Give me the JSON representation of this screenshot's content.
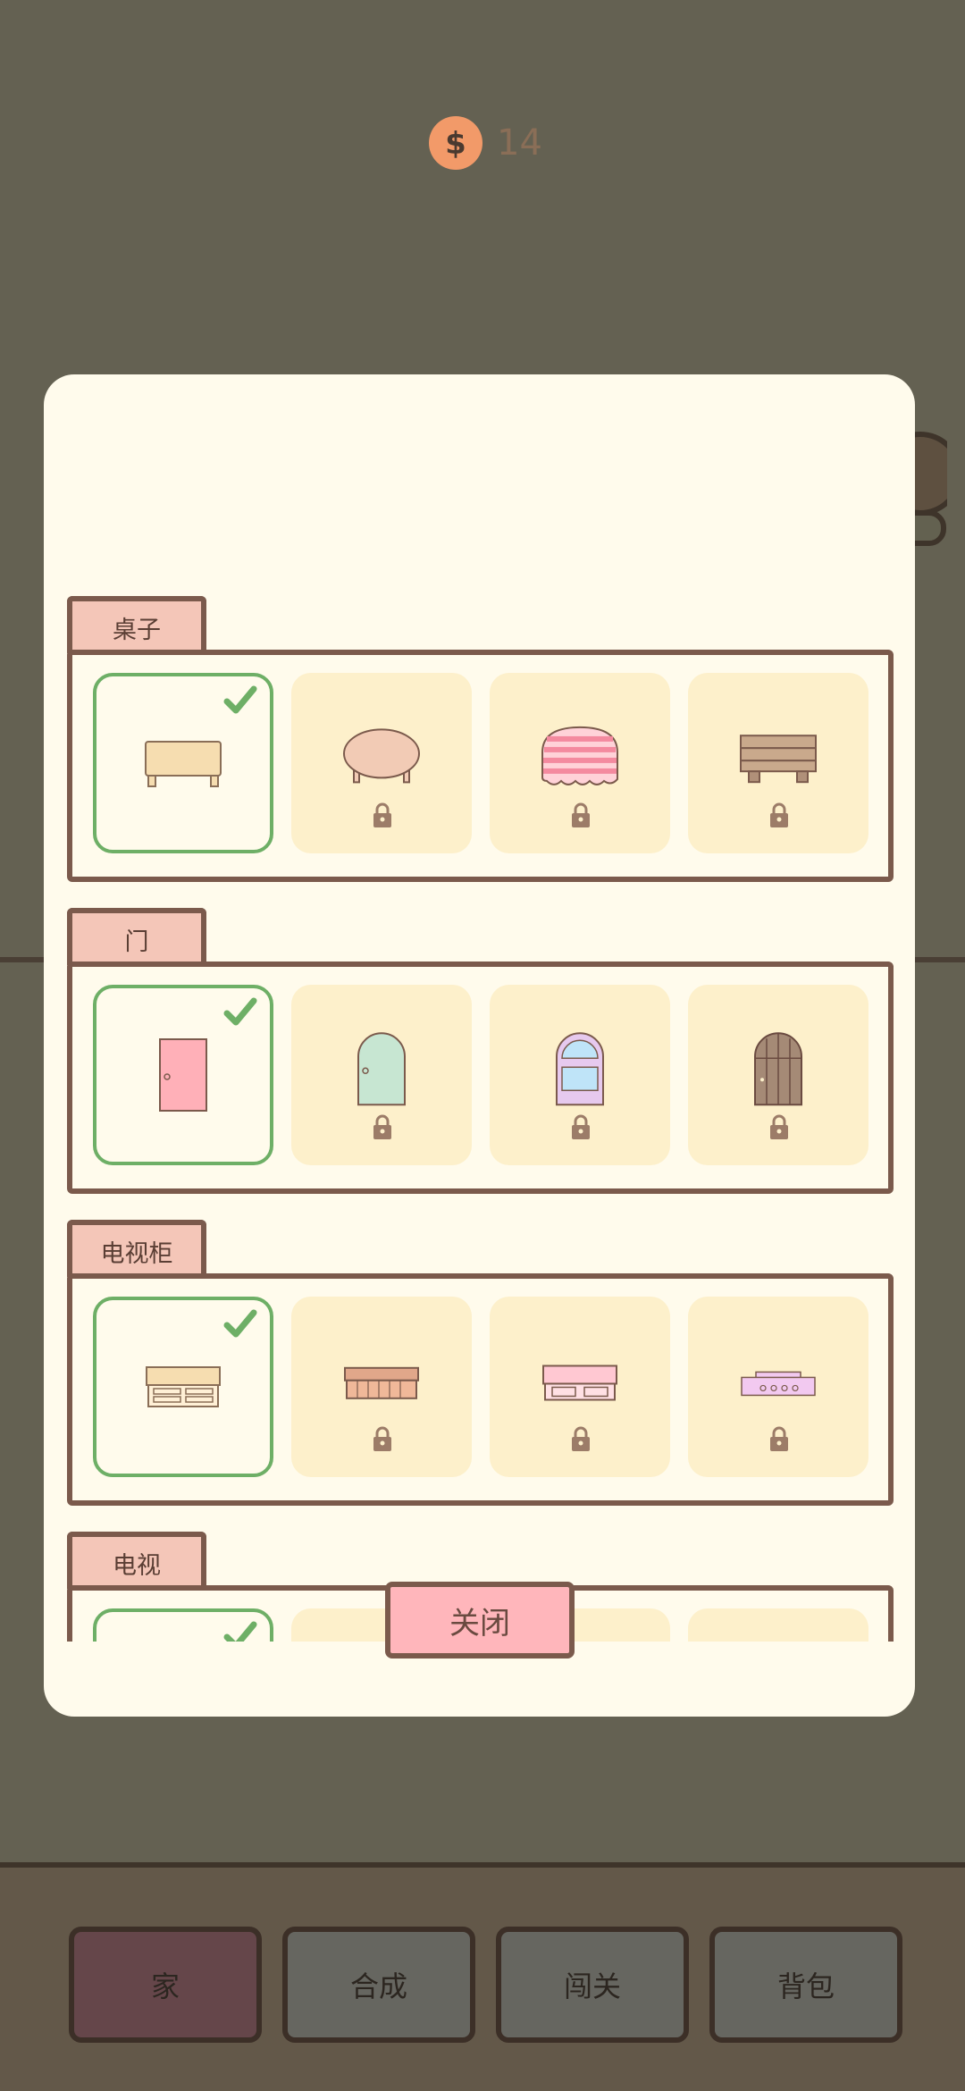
{
  "coins": {
    "amount": "14",
    "icon": "dollar-coin-icon",
    "color": "#f29a69"
  },
  "sections": [
    {
      "title": "桌子",
      "items": [
        {
          "icon": "rectangle-table-icon",
          "selected": true,
          "locked": false
        },
        {
          "icon": "round-table-icon",
          "selected": false,
          "locked": true
        },
        {
          "icon": "striped-tablecloth-table-icon",
          "selected": false,
          "locked": true
        },
        {
          "icon": "wooden-bench-table-icon",
          "selected": false,
          "locked": true
        }
      ]
    },
    {
      "title": "门",
      "items": [
        {
          "icon": "pink-door-icon",
          "selected": true,
          "locked": false
        },
        {
          "icon": "mint-arch-door-icon",
          "selected": false,
          "locked": true
        },
        {
          "icon": "window-arch-door-icon",
          "selected": false,
          "locked": true
        },
        {
          "icon": "wooden-arch-door-icon",
          "selected": false,
          "locked": true
        }
      ]
    },
    {
      "title": "电视柜",
      "items": [
        {
          "icon": "drawer-tv-stand-icon",
          "selected": true,
          "locked": false
        },
        {
          "icon": "brown-tv-stand-icon",
          "selected": false,
          "locked": true
        },
        {
          "icon": "pink-tv-stand-icon",
          "selected": false,
          "locked": true
        },
        {
          "icon": "lilac-tv-stand-icon",
          "selected": false,
          "locked": true
        }
      ]
    },
    {
      "title": "电视",
      "items": [
        {
          "icon": "tv-icon",
          "selected": true,
          "locked": false
        },
        {
          "icon": "tv-icon",
          "selected": false,
          "locked": true
        },
        {
          "icon": "tv-icon",
          "selected": false,
          "locked": true
        },
        {
          "icon": "tv-icon",
          "selected": false,
          "locked": true
        }
      ]
    }
  ],
  "close_label": "关闭",
  "nav": [
    {
      "label": "家",
      "active": true
    },
    {
      "label": "合成",
      "active": false
    },
    {
      "label": "闯关",
      "active": false
    },
    {
      "label": "背包",
      "active": false
    }
  ],
  "colors": {
    "accent": "#ffb6bb",
    "border": "#7b5a4c",
    "selected": "#6eaf66"
  }
}
